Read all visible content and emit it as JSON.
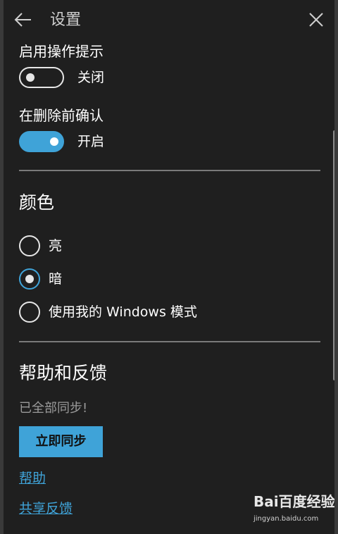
{
  "header": {
    "title": "设置",
    "back_icon": "arrow-left-icon",
    "close_icon": "close-icon"
  },
  "settings": {
    "tips": {
      "label": "启用操作提示",
      "state_label": "关闭",
      "enabled": false
    },
    "confirm_delete": {
      "label": "在删除前确认",
      "state_label": "开启",
      "enabled": true
    }
  },
  "color_section": {
    "title": "颜色",
    "options": [
      {
        "label": "亮",
        "selected": false
      },
      {
        "label": "暗",
        "selected": true
      },
      {
        "label": "使用我的 Windows 模式",
        "selected": false
      }
    ]
  },
  "help_section": {
    "title": "帮助和反馈",
    "sync_status": "已全部同步!",
    "sync_button": "立即同步",
    "links": [
      "帮助",
      "共享反馈"
    ]
  },
  "watermark": {
    "logo_text": "Bai百度经验",
    "url": "jingyan.baidu.com"
  },
  "colors": {
    "accent": "#3fa3d8",
    "background": "#1f1f1f",
    "text": "#ffffff",
    "muted_text": "#9a9a9a",
    "divider": "#7a7a7a"
  }
}
